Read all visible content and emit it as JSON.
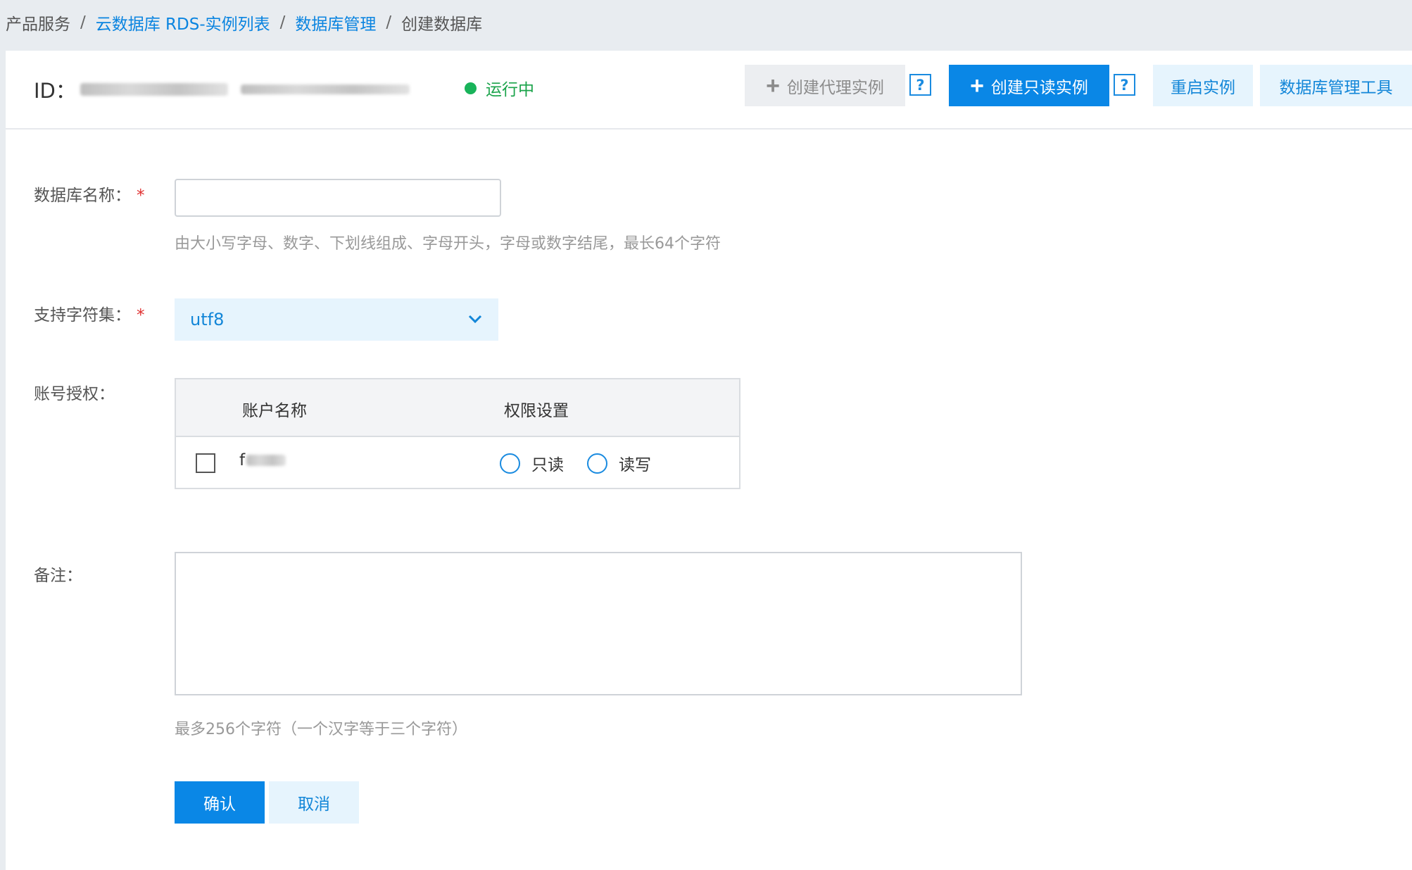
{
  "breadcrumb": {
    "items": [
      {
        "label": "产品服务",
        "link": false
      },
      {
        "label": "云数据库 RDS-实例列表",
        "link": true
      },
      {
        "label": "数据库管理",
        "link": true
      },
      {
        "label": "创建数据库",
        "link": false
      }
    ],
    "separator": "/"
  },
  "header": {
    "id_label": "ID：",
    "id_value_visible": "",
    "status": "运行中",
    "status_color": "#19b35a",
    "buttons": {
      "create_proxy": "创建代理实例",
      "create_readonly": "创建只读实例",
      "restart": "重启实例",
      "db_tool": "数据库管理工具"
    },
    "help": "?"
  },
  "form": {
    "db_name": {
      "label": "数据库名称：",
      "required_mark": "*",
      "value": "",
      "hint": "由大小写字母、数字、下划线组成、字母开头，字母或数字结尾，最长64个字符"
    },
    "charset": {
      "label": "支持字符集：",
      "required_mark": "*",
      "selected": "utf8"
    },
    "account_auth": {
      "label": "账号授权：",
      "columns": [
        "账户名称",
        "权限设置"
      ],
      "rows": [
        {
          "account": "f",
          "checked": false,
          "options": [
            "只读",
            "读写"
          ]
        }
      ]
    },
    "remark": {
      "label": "备注：",
      "value": "",
      "hint": "最多256个字符（一个汉字等于三个字符）"
    },
    "actions": {
      "confirm": "确认",
      "cancel": "取消"
    }
  },
  "colors": {
    "primary": "#0a87e6",
    "link": "#0a84e0",
    "light_button_bg": "#e6f4fd",
    "required": "#e03030"
  }
}
